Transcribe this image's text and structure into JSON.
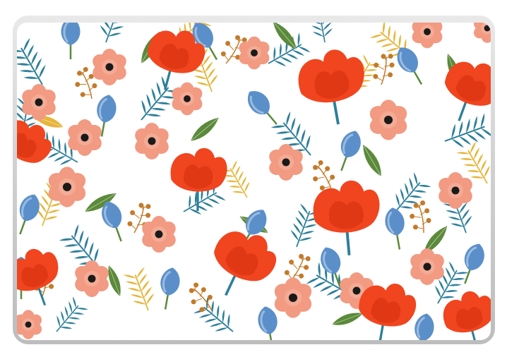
{
  "image": {
    "subject": "laptop-skin",
    "pattern": "watercolor-floral",
    "colors": {
      "frame": "#c9c9c9",
      "frame_highlight": "#e6e6e6",
      "background": "#ffffff",
      "poppy": "#f0451f",
      "poppy_dark": "#d9330f",
      "pink_flower": "#f29a82",
      "pink_center": "#1a1a1a",
      "blue_bud": "#5b8fc9",
      "leaf_teal": "#2c7f9a",
      "leaf_green": "#5b8a3a",
      "leaf_yellow": "#e6b53a",
      "berry": "#c47a2a"
    }
  }
}
